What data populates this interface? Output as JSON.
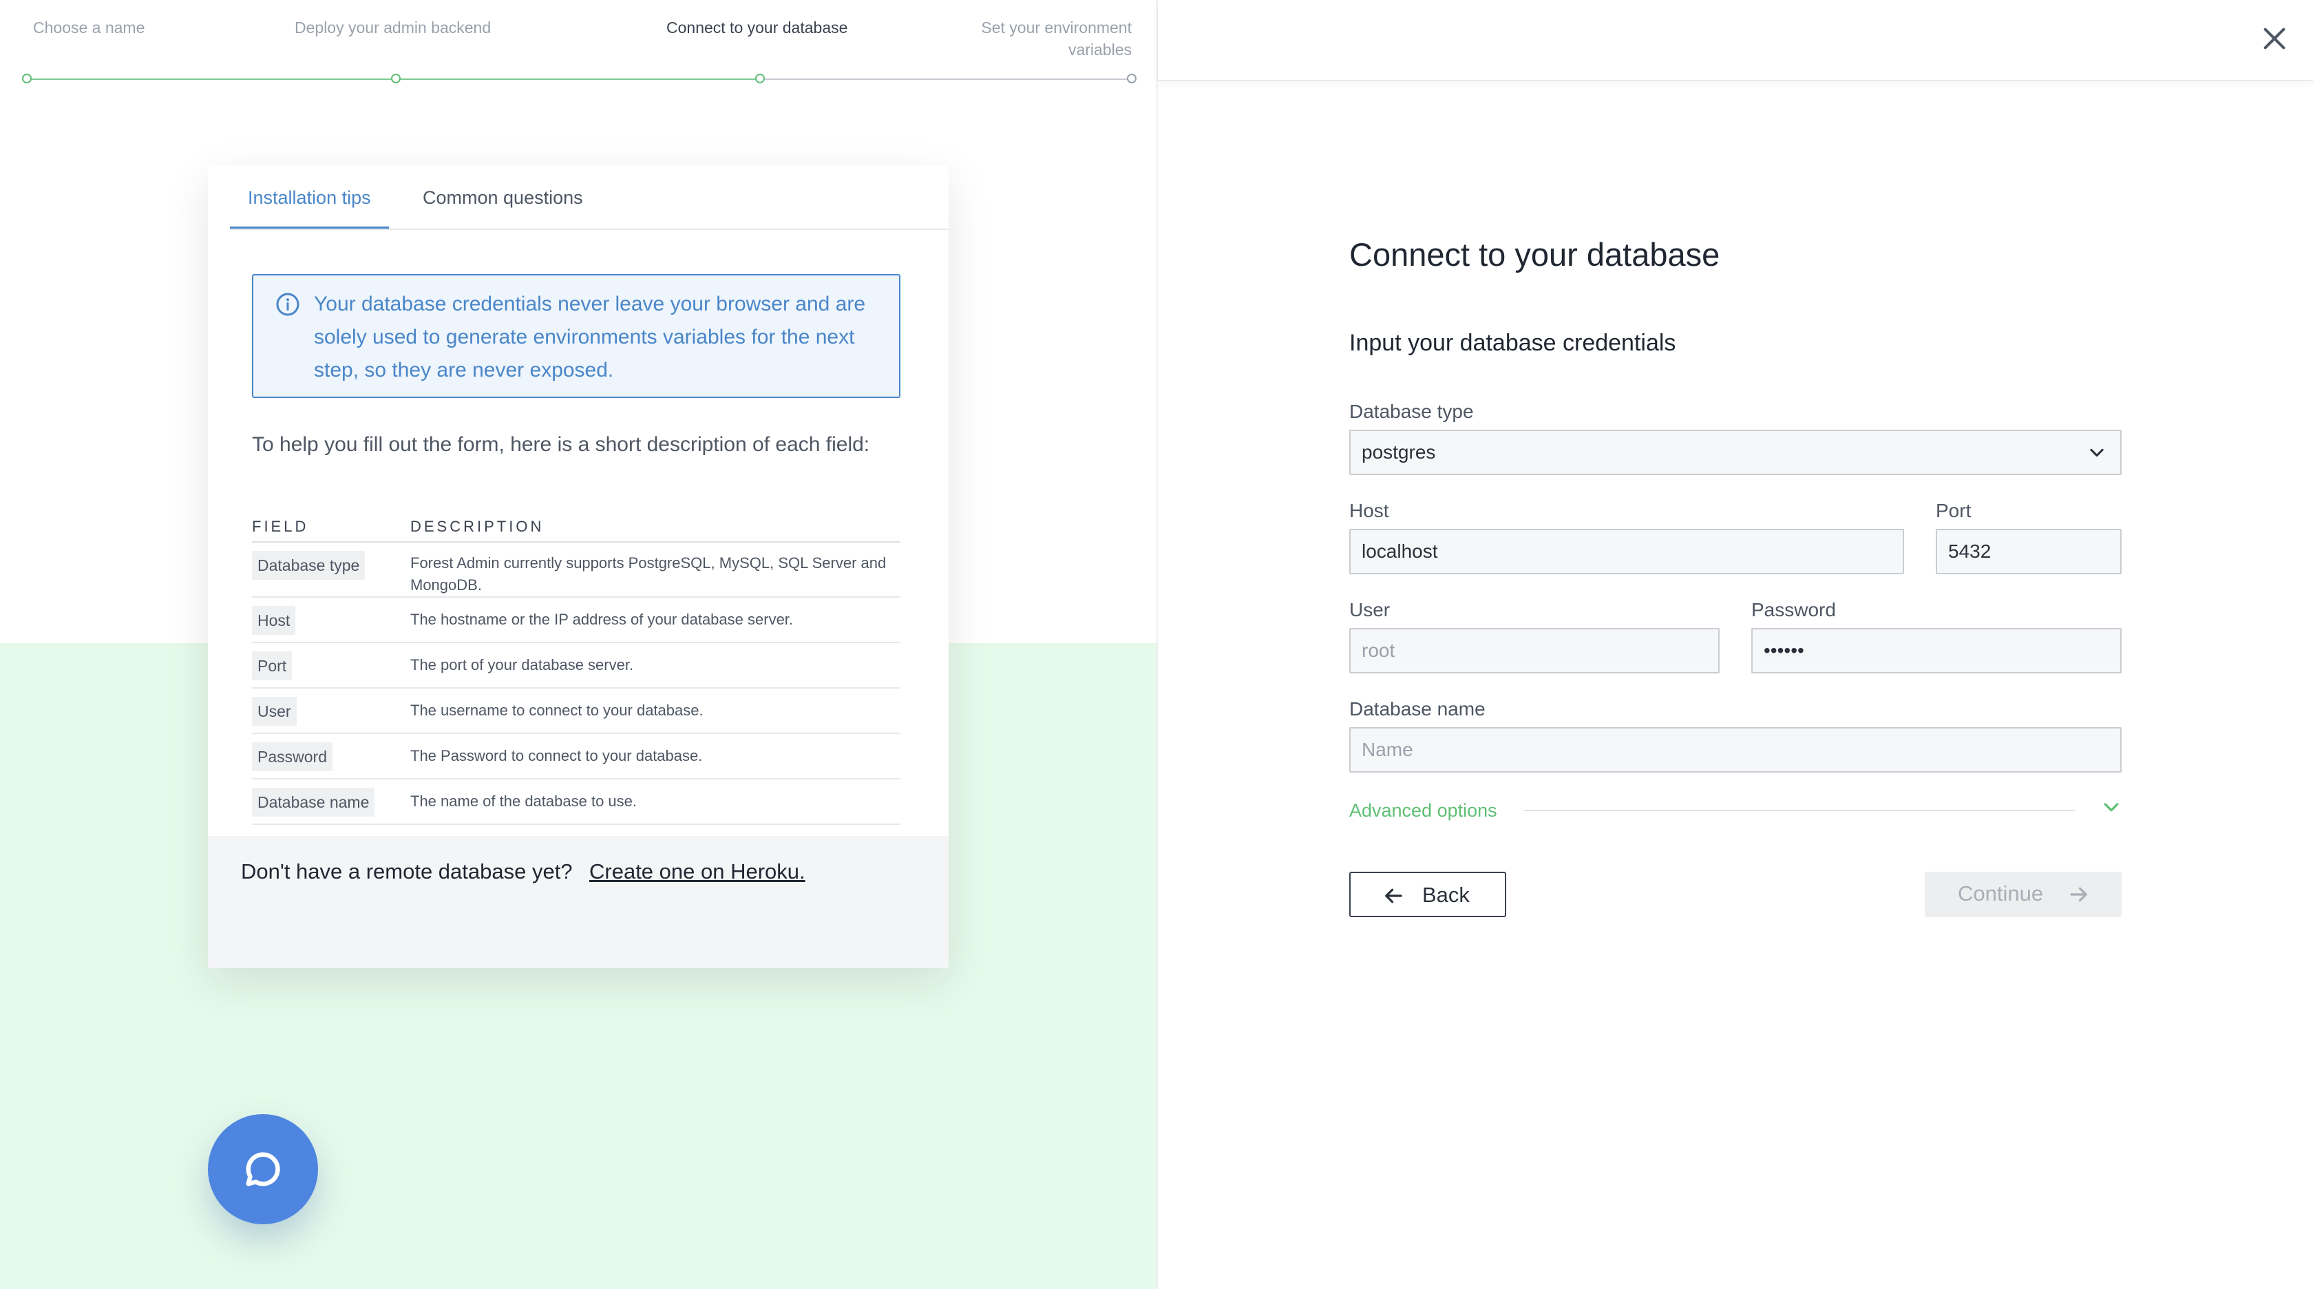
{
  "stepper": {
    "steps": [
      {
        "label": "Choose a name"
      },
      {
        "label": "Deploy your admin backend"
      },
      {
        "label": "Connect to your database"
      },
      {
        "label": "Set your environment variables"
      }
    ],
    "active_index": 2
  },
  "tips": {
    "tabs": [
      {
        "label": "Installation tips"
      },
      {
        "label": "Common questions"
      }
    ],
    "info": "Your database credentials never leave your browser and are solely used to generate environments variables for the next step, so they are never exposed.",
    "help_text": "To help you fill out the form, here is a short description of each field:",
    "table": {
      "headers": {
        "field": "FIELD",
        "description": "DESCRIPTION"
      },
      "rows": [
        {
          "field": "Database type",
          "description": "Forest Admin currently supports PostgreSQL, MySQL, SQL Server and MongoDB."
        },
        {
          "field": "Host",
          "description": "The hostname or the IP address of your database server."
        },
        {
          "field": "Port",
          "description": "The port of your database server."
        },
        {
          "field": "User",
          "description": "The username to connect to your database."
        },
        {
          "field": "Password",
          "description": "The Password to connect to your database."
        },
        {
          "field": "Database name",
          "description": "The name of the database to use."
        }
      ]
    },
    "footer": {
      "text": "Don't have a remote database yet?",
      "link": "Create one on Heroku."
    }
  },
  "form": {
    "title": "Connect to your database",
    "subtitle": "Input your database credentials",
    "database_type": {
      "label": "Database type",
      "value": "postgres"
    },
    "host": {
      "label": "Host",
      "value": "localhost"
    },
    "port": {
      "label": "Port",
      "value": "5432"
    },
    "user": {
      "label": "User",
      "placeholder": "root"
    },
    "password": {
      "label": "Password",
      "value": "••••••"
    },
    "database_name": {
      "label": "Database name",
      "placeholder": "Name"
    },
    "advanced_options": "Advanced options",
    "back": "Back",
    "continue": "Continue"
  },
  "icons": {
    "info": "info-circle-icon",
    "chat": "chat-bubble-icon",
    "close": "close-icon",
    "select": "chevron-down-icon",
    "advanced": "chevron-down-icon",
    "back": "arrow-left-icon",
    "continue": "arrow-right-icon"
  },
  "colors": {
    "accent_blue": "#4a86c8",
    "green": "#5fbf74",
    "chat_blue": "#4d85e0",
    "bg_green": "#e6faeb"
  }
}
